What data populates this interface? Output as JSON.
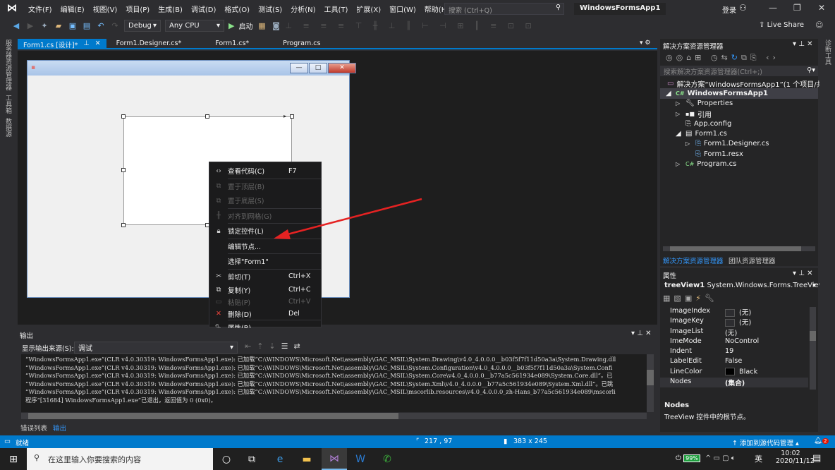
{
  "menu": [
    "文件(F)",
    "编辑(E)",
    "视图(V)",
    "项目(P)",
    "生成(B)",
    "调试(D)",
    "格式(O)",
    "测试(S)",
    "分析(N)",
    "工具(T)",
    "扩展(X)",
    "窗口(W)",
    "帮助(H)"
  ],
  "search_placeholder": "搜索 (Ctrl+Q)",
  "app_title": "WindowsFormsApp1",
  "login": "登录",
  "toolbar": {
    "config": "Debug",
    "platform": "Any CPU",
    "start": "启动",
    "live_share": "Live Share"
  },
  "left_tabs": [
    "服务器资源管理器",
    "工具箱",
    "数据源"
  ],
  "right_tabs": [
    "诊断工具"
  ],
  "tabs": [
    {
      "label": "Form1.cs [设计]*",
      "active": true
    },
    {
      "label": "Form1.Designer.cs*"
    },
    {
      "label": "Form1.cs*"
    },
    {
      "label": "Program.cs"
    }
  ],
  "context_menu": [
    {
      "icon": "code-icon",
      "label": "查看代码(C)",
      "shortcut": "F7"
    },
    {
      "icon": "bring-front-icon",
      "label": "置于顶层(B)",
      "disabled": true
    },
    {
      "icon": "send-back-icon",
      "label": "置于底层(S)",
      "disabled": true
    },
    {
      "icon": "align-grid-icon",
      "label": "对齐到网格(G)",
      "disabled": true
    },
    {
      "icon": "lock-icon",
      "label": "锁定控件(L)"
    },
    {
      "label": "编辑节点..."
    },
    {
      "label": "选择\"Form1\""
    },
    {
      "icon": "cut-icon",
      "label": "剪切(T)",
      "shortcut": "Ctrl+X"
    },
    {
      "icon": "copy-icon",
      "label": "复制(Y)",
      "shortcut": "Ctrl+C"
    },
    {
      "icon": "paste-icon",
      "label": "粘贴(P)",
      "shortcut": "Ctrl+V",
      "disabled": true
    },
    {
      "icon": "delete-icon",
      "label": "删除(D)",
      "shortcut": "Del"
    },
    {
      "icon": "wrench-icon",
      "label": "属性(R)"
    }
  ],
  "output": {
    "title": "输出",
    "source_label": "显示输出来源(S):",
    "source_value": "调试",
    "lines": [
      "“WindowsFormsApp1.exe”(CLR v4.0.30319: WindowsFormsApp1.exe): 已加载“C:\\WINDOWS\\Microsoft.Net\\assembly\\GAC_MSIL\\System.Drawing\\v4.0_4.0.0.0__b03f5f7f11d50a3a\\System.Drawing.dll",
      "“WindowsFormsApp1.exe”(CLR v4.0.30319: WindowsFormsApp1.exe): 已加载“C:\\WINDOWS\\Microsoft.Net\\assembly\\GAC_MSIL\\System.Configuration\\v4.0_4.0.0.0__b03f5f7f11d50a3a\\System.Confi",
      "“WindowsFormsApp1.exe”(CLR v4.0.30319: WindowsFormsApp1.exe): 已加载“C:\\WINDOWS\\Microsoft.Net\\assembly\\GAC_MSIL\\System.Core\\v4.0_4.0.0.0__b77a5c561934e089\\System.Core.dll”。已",
      "“WindowsFormsApp1.exe”(CLR v4.0.30319: WindowsFormsApp1.exe): 已加载“C:\\WINDOWS\\Microsoft.Net\\assembly\\GAC_MSIL\\System.Xml\\v4.0_4.0.0.0__b77a5c561934e089\\System.Xml.dll”。已跳",
      "“WindowsFormsApp1.exe”(CLR v4.0.30319: WindowsFormsApp1.exe): 已加载“C:\\WINDOWS\\Microsoft.Net\\assembly\\GAC_MSIL\\mscorlib.resources\\v4.0_4.0.0.0_zh-Hans_b77a5c561934e089\\mscorli",
      "程序“[31684] WindowsFormsApp1.exe”已退出，返回值为 0 (0x0)。"
    ],
    "bottom_tabs": [
      "错误列表",
      "输出"
    ]
  },
  "solution_explorer": {
    "title": "解决方案资源管理器",
    "search_placeholder": "搜索解决方案资源管理器(Ctrl+;)",
    "items": [
      {
        "label": "解决方案“WindowsFormsApp1”(1 个项目/共 1",
        "level": 0
      },
      {
        "label": "WindowsFormsApp1",
        "level": 1,
        "bold": true,
        "expanded": true
      },
      {
        "label": "Properties",
        "level": 2
      },
      {
        "label": "引用",
        "level": 2
      },
      {
        "label": "App.config",
        "level": 2
      },
      {
        "label": "Form1.cs",
        "level": 2,
        "expanded": true
      },
      {
        "label": "Form1.Designer.cs",
        "level": 3
      },
      {
        "label": "Form1.resx",
        "level": 3
      },
      {
        "label": "Program.cs",
        "level": 2
      }
    ],
    "tabs": [
      "解决方案资源管理器",
      "团队资源管理器"
    ]
  },
  "properties": {
    "title": "属性",
    "object": "treeView1",
    "type": "System.Windows.Forms.TreeView",
    "rows": [
      {
        "name": "ImageIndex",
        "value": "(无)",
        "swatch": "#2d2d30"
      },
      {
        "name": "ImageKey",
        "value": "(无)",
        "swatch": "#2d2d30"
      },
      {
        "name": "ImageList",
        "value": "(无)"
      },
      {
        "name": "ImeMode",
        "value": "NoControl"
      },
      {
        "name": "Indent",
        "value": "19"
      },
      {
        "name": "LabelEdit",
        "value": "False"
      },
      {
        "name": "LineColor",
        "value": "Black",
        "swatch": "#000000"
      },
      {
        "name": "Nodes",
        "value": "(集合)",
        "bold": true
      }
    ],
    "desc_title": "Nodes",
    "desc_text": "TreeView 控件中的根节点。"
  },
  "status": {
    "ready": "就绪",
    "position": "217 , 97",
    "size": "383 x 245",
    "source_control": "添加到源代码管理",
    "notifications": "2"
  },
  "taskbar": {
    "search_placeholder": "在这里输入你要搜索的内容",
    "battery": "99%",
    "ime": "英",
    "time": "10:02",
    "date": "2020/11/12"
  },
  "colors": {
    "accent": "#007acc",
    "arrow": "#e52222"
  }
}
